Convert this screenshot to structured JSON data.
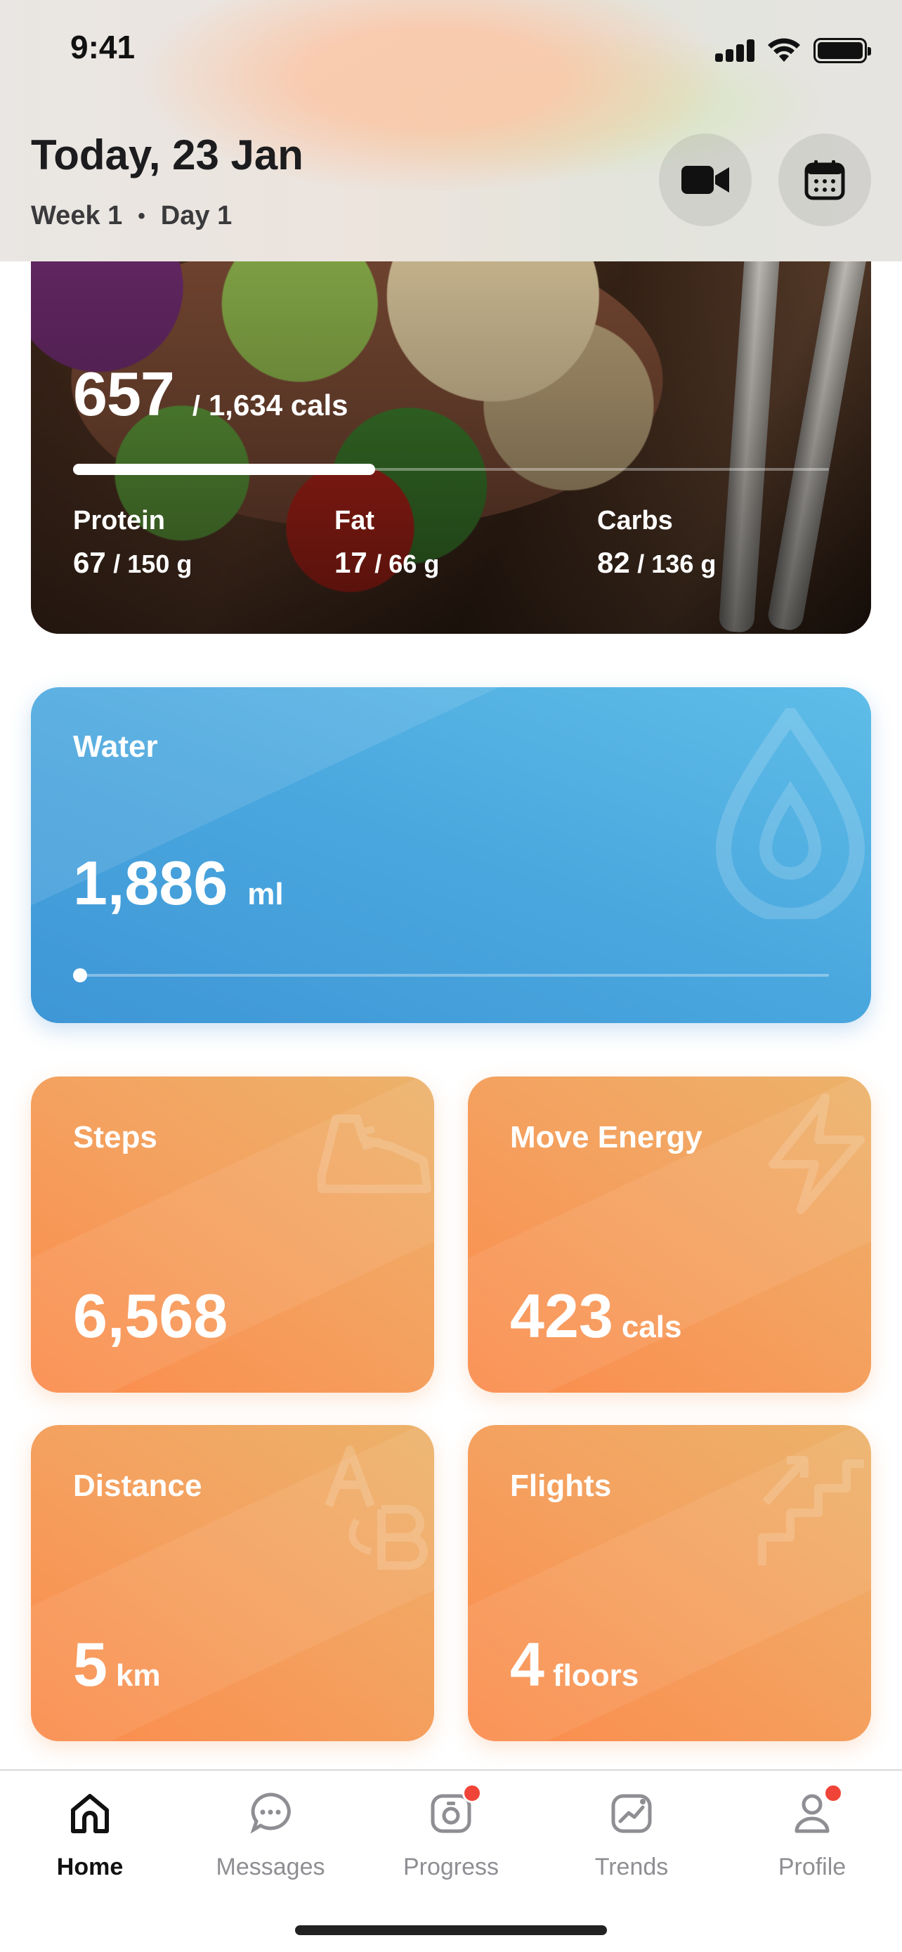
{
  "status_bar": {
    "time": "9:41"
  },
  "header": {
    "title": "Today, 23 Jan",
    "week": "Week 1",
    "separator": "•",
    "day": "Day 1",
    "buttons": [
      "video-camera-icon",
      "calendar-icon"
    ]
  },
  "nutrition": {
    "calories_consumed": "657",
    "slash": "/",
    "calories_goal_label": "1,634 cals",
    "calories_progress": 0.4,
    "macros": [
      {
        "name": "Protein",
        "value": "67",
        "goal": "/ 150 g"
      },
      {
        "name": "Fat",
        "value": "17",
        "goal": "/ 66 g"
      },
      {
        "name": "Carbs",
        "value": "82",
        "goal": "/ 136 g"
      }
    ]
  },
  "water": {
    "title": "Water",
    "value": "1,886",
    "unit": "ml",
    "icon": "water-drop-icon"
  },
  "activity": [
    {
      "title": "Steps",
      "value": "6,568",
      "unit": "",
      "icon": "shoe-icon"
    },
    {
      "title": "Move Energy",
      "value": "423",
      "unit": "cals",
      "icon": "lightning-icon"
    },
    {
      "title": "Distance",
      "value": "5",
      "unit": "km",
      "icon": "a-to-b-icon"
    },
    {
      "title": "Flights",
      "value": "4",
      "unit": "floors",
      "icon": "stairs-icon"
    }
  ],
  "tab_bar": {
    "tabs": [
      {
        "label": "Home",
        "icon": "home-icon",
        "active": true,
        "badge": false
      },
      {
        "label": "Messages",
        "icon": "chat-bubble-icon",
        "active": false,
        "badge": false
      },
      {
        "label": "Progress",
        "icon": "camera-icon",
        "active": false,
        "badge": true
      },
      {
        "label": "Trends",
        "icon": "trend-chart-icon",
        "active": false,
        "badge": false
      },
      {
        "label": "Profile",
        "icon": "person-icon",
        "active": false,
        "badge": true
      }
    ]
  },
  "colors": {
    "water_blue": "#4aa7de",
    "activity_orange": "#f4a260",
    "badge_red": "#f04438"
  }
}
